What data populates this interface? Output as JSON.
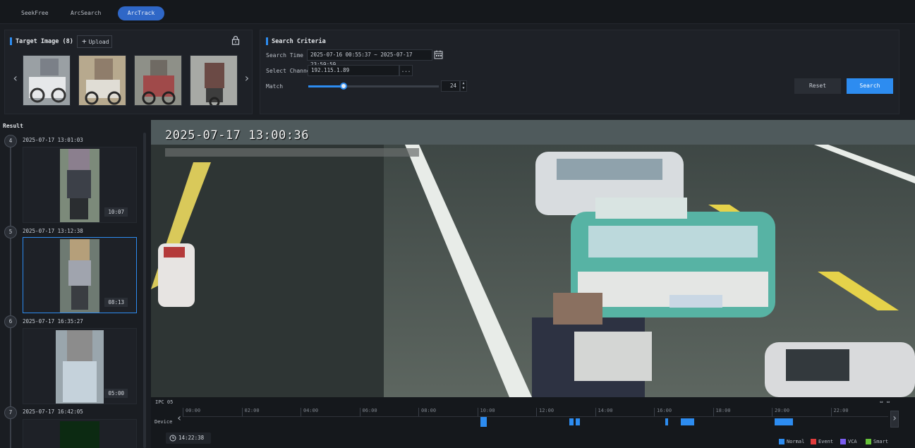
{
  "tabs": [
    {
      "label": "SeekFree",
      "active": false
    },
    {
      "label": "ArcSearch",
      "active": false
    },
    {
      "label": "ArcTrack",
      "active": true
    }
  ],
  "target": {
    "title": "Target Image (8)",
    "upload_label": "Upload",
    "icons": {
      "add": "plus-icon",
      "lock": "lock-icon",
      "prev": "chevron-left-icon",
      "next": "chevron-right-icon"
    }
  },
  "criteria": {
    "title": "Search Criteria",
    "time_label": "Search Time",
    "time_value": "2025-07-16 00:55:37 ~ 2025-07-17 23:59:59",
    "channel_label": "Select Channel",
    "channel_value": "192.115.1.89",
    "channel_more": "...",
    "match_label": "Match",
    "match_value": "24",
    "match_fraction": 0.27,
    "reset_label": "Reset",
    "search_label": "Search"
  },
  "results": {
    "title": "Result",
    "items": [
      {
        "index": "4",
        "time": "2025-07-17 13:01:03",
        "duration": "10:07",
        "selected": false
      },
      {
        "index": "5",
        "time": "2025-07-17 13:12:38",
        "duration": "08:13",
        "selected": true
      },
      {
        "index": "6",
        "time": "2025-07-17 16:35:27",
        "duration": "05:00",
        "selected": false
      },
      {
        "index": "7",
        "time": "2025-07-17 16:42:05",
        "duration": "",
        "selected": false
      }
    ]
  },
  "video": {
    "osd_time": "2025-07-17 13:00:36"
  },
  "timeline": {
    "channel": "IPC 05",
    "row_label": "Device",
    "ticks": [
      "00:00",
      "02:00",
      "04:00",
      "06:00",
      "08:00",
      "10:00",
      "12:00",
      "14:00",
      "16:00",
      "18:00",
      "20:00",
      "22:00"
    ],
    "current_time": "14:22:38",
    "legend": [
      {
        "label": "Normal",
        "color": "#2d8cf0"
      },
      {
        "label": "Event",
        "color": "#e03b3b"
      },
      {
        "label": "VCA",
        "color": "#7a5cf0"
      },
      {
        "label": "Smart",
        "color": "#67c23a"
      }
    ]
  },
  "colors": {
    "accent": "#2d8cf0",
    "background": "#1a1d22",
    "panel": "#1e2127"
  }
}
